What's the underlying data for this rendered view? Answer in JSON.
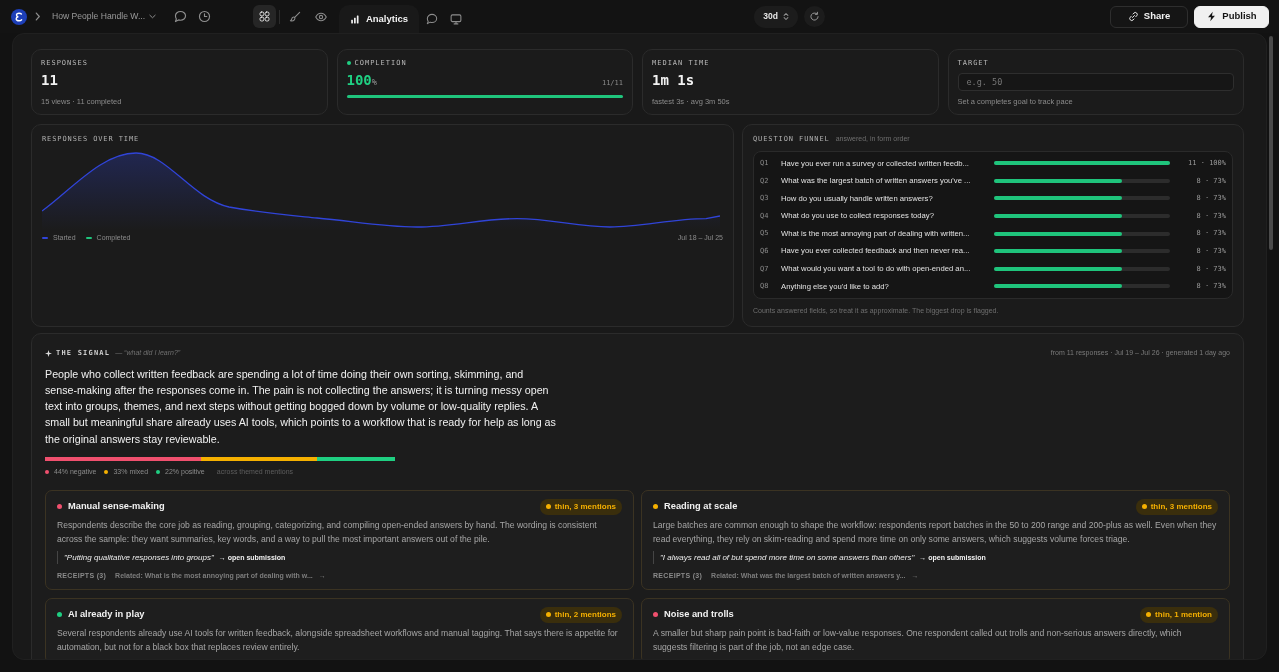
{
  "topbar": {
    "breadcrumb": "How People Handle W...",
    "left_icons": [
      {
        "kind": "chat"
      },
      {
        "kind": "clock"
      }
    ],
    "view_buttons": [
      {
        "kind": "grid",
        "selected": true
      },
      {
        "kind": "brush",
        "selected": false
      },
      {
        "kind": "eye",
        "selected": false
      }
    ],
    "tabs": [
      {
        "kind": "chart",
        "label": "Analytics",
        "selected": true
      },
      {
        "kind": "chat",
        "selected": false
      },
      {
        "kind": "monitor",
        "selected": false
      }
    ],
    "range": "30d",
    "actions": [
      {
        "kind": "share",
        "label": "Share"
      },
      {
        "kind": "publish",
        "label": "Publish"
      }
    ]
  },
  "stats": [
    {
      "kind": "count",
      "label": "RESPONSES",
      "value": "11",
      "note": "15 views · 11 completed"
    },
    {
      "kind": "progress",
      "label": "COMPLETION",
      "value": "100",
      "unit": "%",
      "ratio": "11/11",
      "level": 1
    },
    {
      "kind": "count",
      "label": "MEDIAN TIME",
      "value": "1m 1s",
      "note": "fastest 3s · avg 3m 50s"
    },
    {
      "kind": "input",
      "label": "TARGET",
      "placeholder": "e.g. 50",
      "note": "Set a completes goal to track pace"
    }
  ],
  "chart": {
    "title": "RESPONSES OVER TIME",
    "legend": [
      {
        "label": "Started",
        "color": "#3044d8"
      },
      {
        "label": "Completed",
        "color": "#1fc47c"
      }
    ],
    "range": "Jul 18 – Jul 25"
  },
  "funnel": {
    "title": "QUESTION FUNNEL",
    "subtitle": "answered, in form order",
    "rows": [
      {
        "number": "Q1",
        "question": "Have you ever run a survey or collected written feedb...",
        "level": 1,
        "reading": "11 · 100%"
      },
      {
        "number": "Q2",
        "question": "What was the largest batch of written answers you've ...",
        "level": 0.73,
        "reading": "8 · 73%"
      },
      {
        "number": "Q3",
        "question": "How do you usually handle written answers?",
        "level": 0.73,
        "reading": "8 · 73%"
      },
      {
        "number": "Q4",
        "question": "What do you use to collect responses today?",
        "level": 0.73,
        "reading": "8 · 73%"
      },
      {
        "number": "Q5",
        "question": "What is the most annoying part of dealing with written...",
        "level": 0.73,
        "reading": "8 · 73%"
      },
      {
        "number": "Q6",
        "question": "Have you ever collected feedback and then never rea...",
        "level": 0.73,
        "reading": "8 · 73%"
      },
      {
        "number": "Q7",
        "question": "What would you want a tool to do with open-ended an...",
        "level": 0.73,
        "reading": "8 · 73%"
      },
      {
        "number": "Q8",
        "question": "Anything else you'd like to add?",
        "level": 0.73,
        "reading": "8 · 73%"
      }
    ],
    "note": "Counts answered fields, so treat it as approximate. The biggest drop is flagged."
  },
  "signal": {
    "title": "THE SIGNAL",
    "subtitle": "— “what did I learn?”",
    "meta": "from 11 responses · Jul 19 – Jul 26 · generated 1 day ago",
    "summary": "People who collect written feedback are spending a lot of time doing their own sorting, skimming, and sense-making after the responses come in. The pain is not collecting the answers; it is turning messy open text into groups, themes, and next steps without getting bogged down by volume or low-quality replies. A small but meaningful share already uses AI tools, which points to a workflow that is ready for help as long as the original answers stay reviewable.",
    "sentiment": {
      "legend": [
        {
          "label": "44% negative",
          "color": "#f0506e"
        },
        {
          "label": "33% mixed",
          "color": "#f5b000"
        },
        {
          "label": "22% positive",
          "color": "#1fcf82"
        }
      ],
      "note": "across themed mentions"
    },
    "themes": [
      {
        "title": "Manual sense-making",
        "color": "#f0506e",
        "badge": "thin, 3 mentions",
        "text": "Respondents describe the core job as reading, grouping, categorizing, and compiling open-ended answers by hand. The wording is consistent across the sample: they want summaries, key words, and a way to pull the most important answers out of the pile.",
        "quote": "\"Putting qualitative responses into groups\"",
        "link": "→ open submission",
        "receipts": "RECEIPTS (3)",
        "related": "Related: What is the most annoying part of dealing with w...",
        "arrow": "→"
      },
      {
        "title": "Reading at scale",
        "color": "#f5b000",
        "badge": "thin, 3 mentions",
        "text": "Large batches are common enough to shape the workflow: respondents report batches in the 50 to 200 range and 200-plus as well. Even when they read everything, they rely on skim-reading and spend more time on only some answers, which suggests volume forces triage.",
        "quote": "\"I always read all of but spend more time on some answers than others\"",
        "link": "→ open submission",
        "receipts": "RECEIPTS (3)",
        "related": "Related: What was the largest batch of written answers y...",
        "arrow": "→"
      },
      {
        "title": "AI already in play",
        "color": "#1fcf82",
        "badge": "thin, 2 mentions",
        "text": "Several respondents already use AI tools for written feedback, alongside spreadsheet workflows and manual tagging. That says there is appetite for automation, but not for a black box that replaces review entirely."
      },
      {
        "title": "Noise and trolls",
        "color": "#f0506e",
        "badge": "thin, 1 mention",
        "text": "A smaller but sharp pain point is bad-faith or low-value responses. One respondent called out trolls and non-serious answers directly, which suggests filtering is part of the job, not an edge case."
      }
    ]
  }
}
